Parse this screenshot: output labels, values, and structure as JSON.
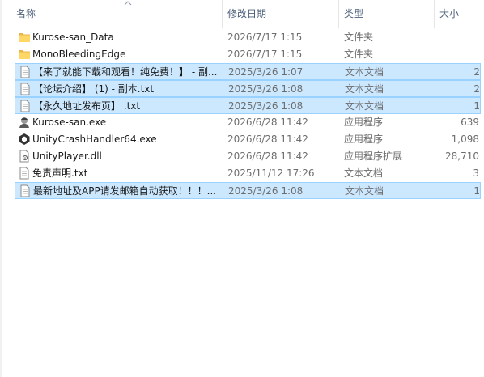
{
  "columns": {
    "name": "名称",
    "date": "修改日期",
    "type": "类型",
    "size": "大小"
  },
  "files": [
    {
      "name": "Kurose-san_Data",
      "date": "2026/7/17 1:15",
      "type": "文件夹",
      "size": "",
      "icon": "folder-icon",
      "selected": false
    },
    {
      "name": "MonoBleedingEdge",
      "date": "2026/7/17 1:15",
      "type": "文件夹",
      "size": "",
      "icon": "folder-icon",
      "selected": false
    },
    {
      "name": "【来了就能下载和观看！纯免费！】 - 副...",
      "date": "2025/3/26 1:07",
      "type": "文本文档",
      "size": "2",
      "icon": "text-file-icon",
      "selected": true
    },
    {
      "name": "【论坛介绍】 (1) - 副本.txt",
      "date": "2025/3/26 1:08",
      "type": "文本文档",
      "size": "2",
      "icon": "text-file-icon",
      "selected": true
    },
    {
      "name": "【永久地址发布页】 .txt",
      "date": "2025/3/26 1:08",
      "type": "文本文档",
      "size": "1",
      "icon": "text-file-icon",
      "selected": true
    },
    {
      "name": "Kurose-san.exe",
      "date": "2026/6/28 11:42",
      "type": "应用程序",
      "size": "639",
      "icon": "game-exe-icon",
      "selected": false
    },
    {
      "name": "UnityCrashHandler64.exe",
      "date": "2026/6/28 11:42",
      "type": "应用程序",
      "size": "1,098",
      "icon": "unity-icon",
      "selected": false
    },
    {
      "name": "UnityPlayer.dll",
      "date": "2026/6/28 11:42",
      "type": "应用程序扩展",
      "size": "28,710",
      "icon": "dll-file-icon",
      "selected": false
    },
    {
      "name": "免责声明.txt",
      "date": "2025/11/12 17:26",
      "type": "文本文档",
      "size": "3",
      "icon": "text-file-icon",
      "selected": false
    },
    {
      "name": "最新地址及APP请发邮箱自动获取！！！...",
      "date": "2025/3/26 1:08",
      "type": "文本文档",
      "size": "1",
      "icon": "text-file-icon",
      "selected": true
    }
  ]
}
